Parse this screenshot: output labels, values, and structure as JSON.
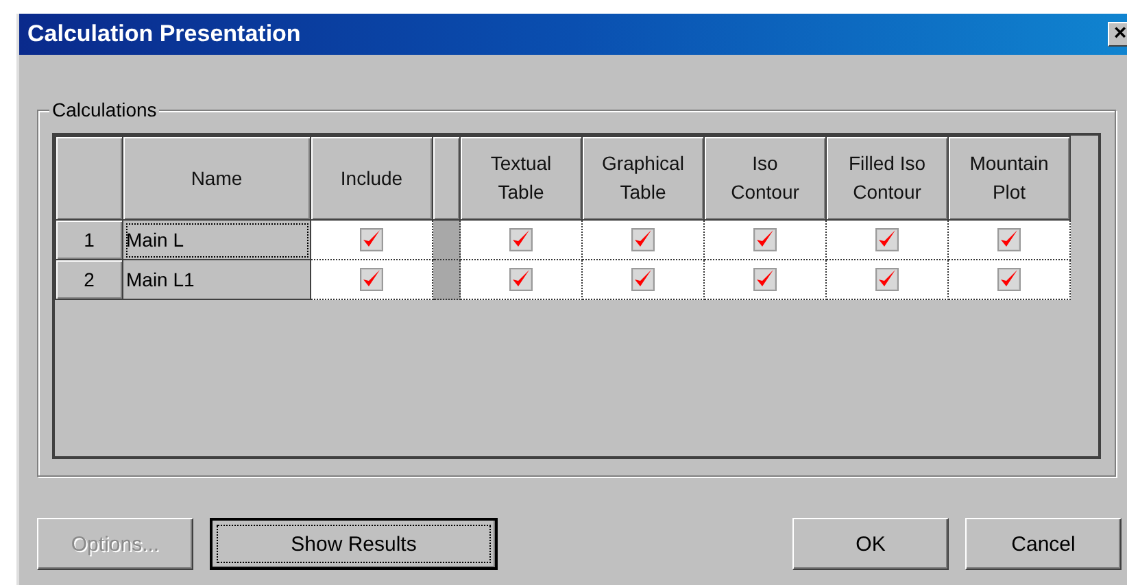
{
  "window": {
    "title": "Calculation Presentation",
    "close": "×"
  },
  "group": {
    "title": "Calculations"
  },
  "table": {
    "columns": [
      {
        "kind": "text",
        "lines": [
          "Name"
        ]
      },
      {
        "kind": "check",
        "lines": [
          "Include"
        ]
      },
      {
        "kind": "spacer"
      },
      {
        "kind": "check",
        "lines": [
          "Textual",
          "Table"
        ]
      },
      {
        "kind": "check",
        "lines": [
          "Graphical",
          "Table"
        ]
      },
      {
        "kind": "check",
        "lines": [
          "Iso",
          "Contour"
        ]
      },
      {
        "kind": "check",
        "lines": [
          "Filled Iso",
          "Contour"
        ]
      },
      {
        "kind": "check",
        "lines": [
          "Mountain",
          "Plot"
        ]
      }
    ],
    "rows": [
      {
        "number": "1",
        "name": "Main L",
        "selected": true,
        "checks": [
          true,
          true,
          true,
          true,
          true,
          true
        ]
      },
      {
        "number": "2",
        "name": "Main L1",
        "selected": false,
        "checks": [
          true,
          true,
          true,
          true,
          true,
          true
        ]
      }
    ]
  },
  "buttons": [
    {
      "label": "Options...",
      "disabled": true,
      "default": false,
      "kind": "left"
    },
    {
      "label": "Show Results",
      "disabled": false,
      "default": true,
      "kind": "left"
    },
    {
      "label": "OK",
      "disabled": false,
      "default": false,
      "kind": "right"
    },
    {
      "label": "Cancel",
      "disabled": false,
      "default": false,
      "kind": "right"
    }
  ]
}
